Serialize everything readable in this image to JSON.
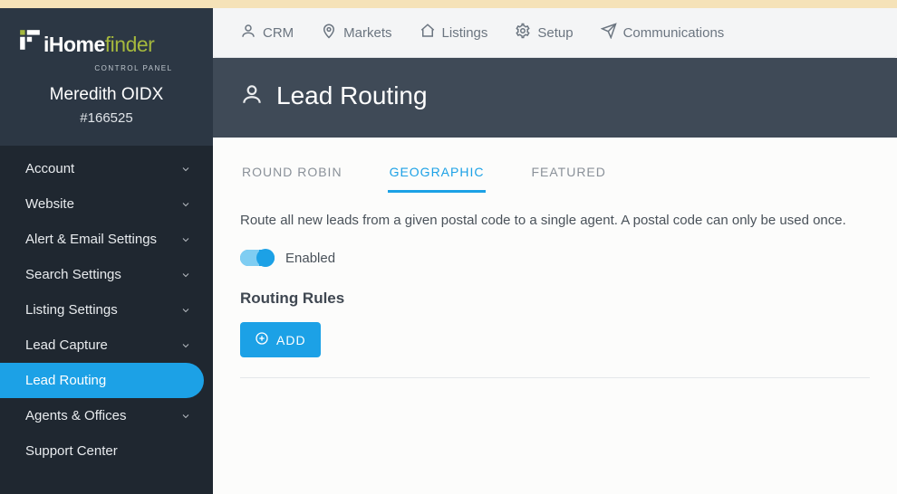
{
  "brand": {
    "strong": "iHome",
    "light": "finder",
    "sub": "CONTROL PANEL"
  },
  "user": {
    "name": "Meredith OIDX",
    "id": "#166525"
  },
  "sidebar": {
    "items": [
      {
        "label": "Account",
        "expandable": true
      },
      {
        "label": "Website",
        "expandable": true
      },
      {
        "label": "Alert & Email Settings",
        "expandable": true
      },
      {
        "label": "Search Settings",
        "expandable": true
      },
      {
        "label": "Listing Settings",
        "expandable": true
      },
      {
        "label": "Lead Capture",
        "expandable": true
      },
      {
        "label": "Lead Routing",
        "expandable": false,
        "active": true
      },
      {
        "label": "Agents & Offices",
        "expandable": true
      },
      {
        "label": "Support Center",
        "expandable": false
      }
    ]
  },
  "topnav": {
    "items": [
      {
        "label": "CRM"
      },
      {
        "label": "Markets"
      },
      {
        "label": "Listings"
      },
      {
        "label": "Setup"
      },
      {
        "label": "Communications"
      }
    ]
  },
  "page": {
    "title": "Lead Routing",
    "tabs": [
      {
        "label": "ROUND ROBIN"
      },
      {
        "label": "GEOGRAPHIC",
        "active": true
      },
      {
        "label": "FEATURED"
      }
    ],
    "description": "Route all new leads from a given postal code to a single agent. A postal code can only be used once.",
    "toggle_label": "Enabled",
    "section_title": "Routing Rules",
    "add_label": "ADD"
  }
}
